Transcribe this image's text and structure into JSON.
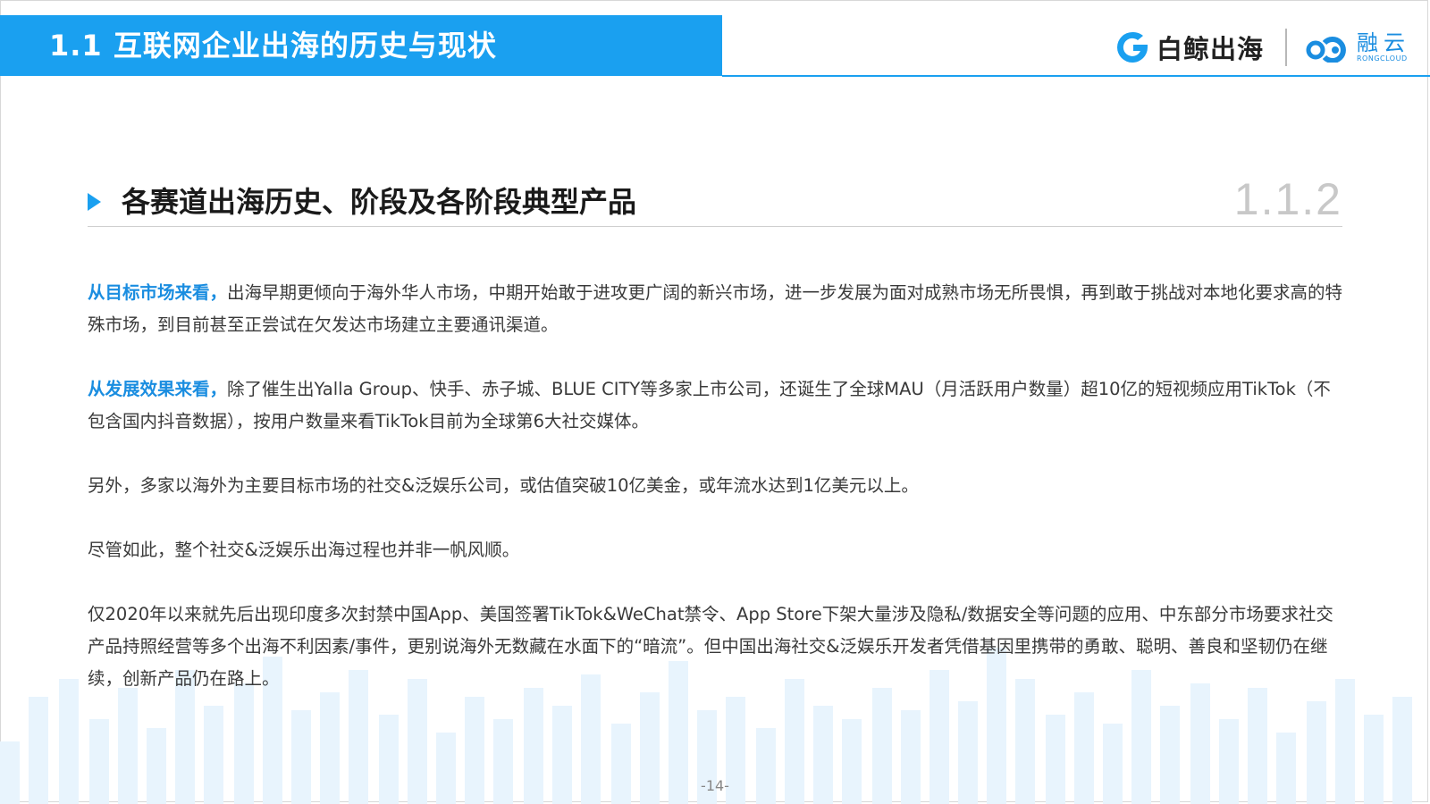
{
  "header": {
    "title": "1.1 互联网企业出海的历史与现状",
    "logo_baijing": "白鲸出海",
    "logo_rong_cn": "融云",
    "logo_rong_en": "RONGCLOUD"
  },
  "section": {
    "title": "各赛道出海历史、阶段及各阶段典型产品",
    "number": "1.1.2"
  },
  "paragraphs": [
    {
      "lead": "从目标市场来看，",
      "text": "出海早期更倾向于海外华人市场，中期开始敢于进攻更广阔的新兴市场，进一步发展为面对成熟市场无所畏惧，再到敢于挑战对本地化要求高的特殊市场，到目前甚至正尝试在欠发达市场建立主要通讯渠道。"
    },
    {
      "lead": "从发展效果来看，",
      "text": "除了催生出Yalla Group、快手、赤子城、BLUE CITY等多家上市公司，还诞生了全球MAU（月活跃用户数量）超10亿的短视频应用TikTok（不包含国内抖音数据），按用户数量来看TikTok目前为全球第6大社交媒体。"
    },
    {
      "lead": "",
      "text": "另外，多家以海外为主要目标市场的社交&泛娱乐公司，或估值突破10亿美金，或年流水达到1亿美元以上。"
    },
    {
      "lead": "",
      "text": "尽管如此，整个社交&泛娱乐出海过程也并非一帆风顺。"
    },
    {
      "lead": "",
      "text": "仅2020年以来就先后出现印度多次封禁中国App、美国签署TikTok&WeChat禁令、App Store下架大量涉及隐私/数据安全等问题的应用、中东部分市场要求社交产品持照经营等多个出海不利因素/事件，更别说海外无数藏在水面下的“暗流”。但中国出海社交&泛娱乐开发者凭借基因里携带的勇敢、聪明、善良和坚韧仍在继续，创新产品仍在路上。"
    }
  ],
  "footer": {
    "page_number": "-14-"
  },
  "colors": {
    "accent": "#1aa0f0",
    "lead_text": "#1a8de0",
    "bar_light": "#e4f2fc"
  }
}
